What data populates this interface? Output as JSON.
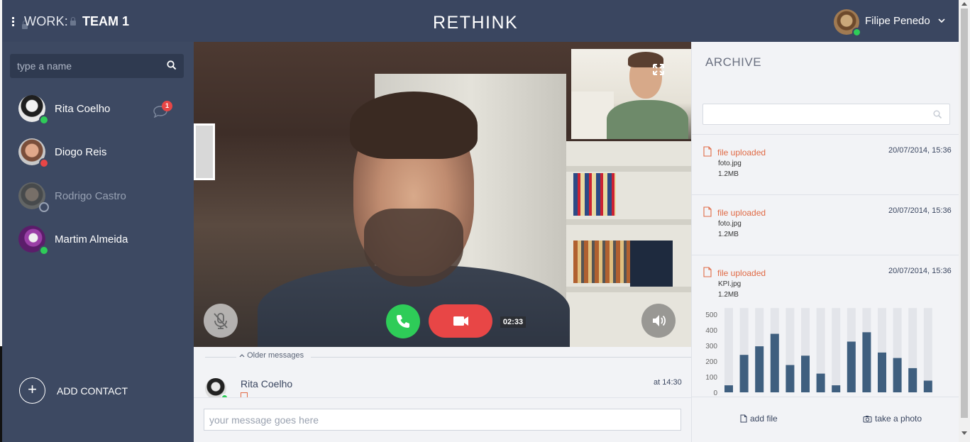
{
  "header": {
    "workspace_label": "WORK:",
    "team_label": "TEAM 1",
    "logo_text": "RETHINK",
    "user_name": "Filipe Penedo",
    "user_status_color": "#2ecc58"
  },
  "sidebar": {
    "search_placeholder": "type a name",
    "contacts": [
      {
        "name": "Rita Coelho",
        "status": "online",
        "status_color": "#2ecc58",
        "unread": "1"
      },
      {
        "name": "Diogo Reis",
        "status": "busy",
        "status_color": "#e84646"
      },
      {
        "name": "Rodrigo Castro",
        "status": "offline",
        "status_color": "#97a1b3"
      },
      {
        "name": "Martim Almeida",
        "status": "online",
        "status_color": "#2ecc58"
      }
    ],
    "add_contact_label": "ADD CONTACT"
  },
  "call": {
    "timer": "02:33",
    "icons": [
      "mic-off-icon",
      "phone-icon",
      "video-camera-icon",
      "volume-icon",
      "expand-icon"
    ]
  },
  "messages": {
    "older_label": "Older messages",
    "items": [
      {
        "sender": "Rita Coelho",
        "time": "at 14:30"
      }
    ],
    "composer_placeholder": "your message goes here"
  },
  "archive": {
    "title": "ARCHIVE",
    "search_placeholder": "",
    "items": [
      {
        "label": "file uploaded",
        "date": "20/07/2014, 15:36",
        "file": "foto.jpg",
        "size": "1.2MB"
      },
      {
        "label": "file uploaded",
        "date": "20/07/2014, 15:36",
        "file": "foto.jpg",
        "size": "1.2MB"
      },
      {
        "label": "file uploaded",
        "date": "20/07/2014, 15:36",
        "file": "KPI.jpg",
        "size": "1.2MB"
      }
    ],
    "actions": {
      "add_file": "add file",
      "take_photo": "take a photo"
    }
  },
  "colors": {
    "header_bg": "#3a4660",
    "sidebar_bg": "#3d4962",
    "accent_orange": "#e06a45",
    "bar_color": "#3f5f7f",
    "bar_track": "#e3e5ea"
  },
  "chart_data": {
    "type": "bar",
    "title": "",
    "xlabel": "",
    "ylabel": "",
    "ylim": [
      0,
      500
    ],
    "yticks": [
      "0",
      "100",
      "200",
      "300",
      "400",
      "500"
    ],
    "series": [
      {
        "values": [
          45,
          240,
          295,
          375,
          175,
          235,
          120,
          45,
          325,
          385,
          255,
          220,
          155,
          75
        ]
      }
    ],
    "background_track_value": 540
  }
}
